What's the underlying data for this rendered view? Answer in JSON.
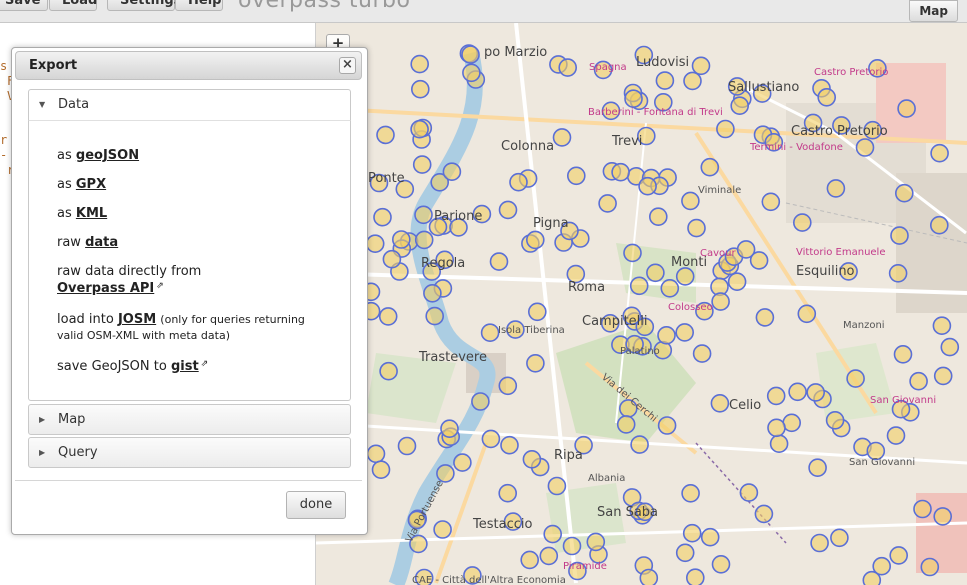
{
  "app": {
    "title": "overpass turbo",
    "toolbar": {
      "save_label": "Save",
      "load_label": "Load",
      "settings_label": "Settings",
      "help_label": "Help",
      "map_label": "Map"
    }
  },
  "editor": {
    "fragments": [
      "s",
      "F",
      "V",
      "r",
      "-",
      "r"
    ]
  },
  "map": {
    "zoom_in_label": "+",
    "labels": {
      "ludovisi": "Ludovisi",
      "sallustiano": "Sallustiano",
      "campo_marzio": "po Marzio",
      "castro_pretorio_poi": "Castro Pretorio",
      "castro_pretorio": "Castro Pretorio",
      "spagna": "Spagna",
      "barberini": "Barberini - Fontana di Trevi",
      "trevi": "Trevi",
      "termini": "Termini - Vodafone",
      "colonna": "Colonna",
      "ponte": "Ponte",
      "viminale": "Viminale",
      "parione": "Parione",
      "pigna": "Pigna",
      "regola": "Regola",
      "monti": "Monti",
      "roma": "Roma",
      "esquilino": "Esquilino",
      "vittorio": "Vittorio Emanuele",
      "cavour": "Cavour",
      "campitelli": "Campitelli",
      "colosseo": "Colosseo",
      "isola": "Isola Tiberina",
      "trastevere": "Trastevere",
      "palatino": "Palatino",
      "celio": "Celio",
      "manzoni": "Manzoni",
      "san_giovanni_poi": "San Giovanni",
      "san_giovanni": "San Giovanni",
      "ripa": "Ripa",
      "albania": "Albania",
      "testaccio": "Testaccio",
      "san_saba": "San Saba",
      "piramide": "Piramide",
      "via_dei_cerchi": "Via dei Cerchi",
      "via_portuense": "Via Portuense",
      "caE": "CAE - Città dell'Altra Economia"
    },
    "colors": {
      "marker_fill": "#f1cf66",
      "marker_stroke": "#5a6fd6"
    }
  },
  "dialog": {
    "title": "Export",
    "close_icon": "close-icon",
    "sections": {
      "data": "Data",
      "map": "Map",
      "query": "Query"
    },
    "rows": {
      "geojson_prefix": "as",
      "geojson_link": "geoJSON",
      "gpx_prefix": "as",
      "gpx_link": "GPX",
      "kml_prefix": "as",
      "kml_link": "KML",
      "raw_prefix": "raw",
      "raw_link": "data",
      "overpass_prefix": "raw data directly from",
      "overpass_link": "Overpass API",
      "josm_prefix": "load into",
      "josm_link": "JOSM",
      "josm_note": "(only for queries returning",
      "josm_note2": "valid OSM-XML with meta data)",
      "gist_prefix": "save GeoJSON to",
      "gist_link": "gist"
    },
    "done_label": "done"
  }
}
